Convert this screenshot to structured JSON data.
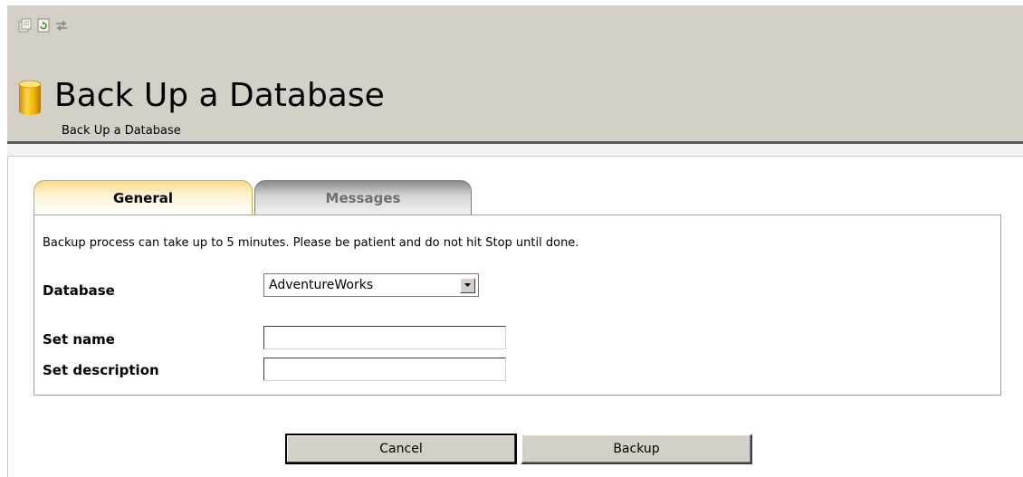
{
  "toolbar": {
    "icons": [
      "properties-icon",
      "refresh-icon",
      "connect-icon"
    ]
  },
  "header": {
    "title": "Back Up a Database",
    "subtitle": "Back Up a Database"
  },
  "tabs": [
    {
      "label": "General",
      "active": true
    },
    {
      "label": "Messages",
      "active": false
    }
  ],
  "form": {
    "notice": "Backup process can take up to 5 minutes. Please be patient and do not hit Stop until done.",
    "database_label": "Database",
    "database_value": "AdventureWorks",
    "set_name_label": "Set name",
    "set_name_value": "",
    "set_description_label": "Set description",
    "set_description_value": ""
  },
  "buttons": {
    "cancel": "Cancel",
    "backup": "Backup"
  },
  "colors": {
    "header_bg": "#d4d0c8",
    "active_tab": "#f6d98a",
    "inactive_tab": "#8a8a8a",
    "db_icon": "#f0b400"
  }
}
